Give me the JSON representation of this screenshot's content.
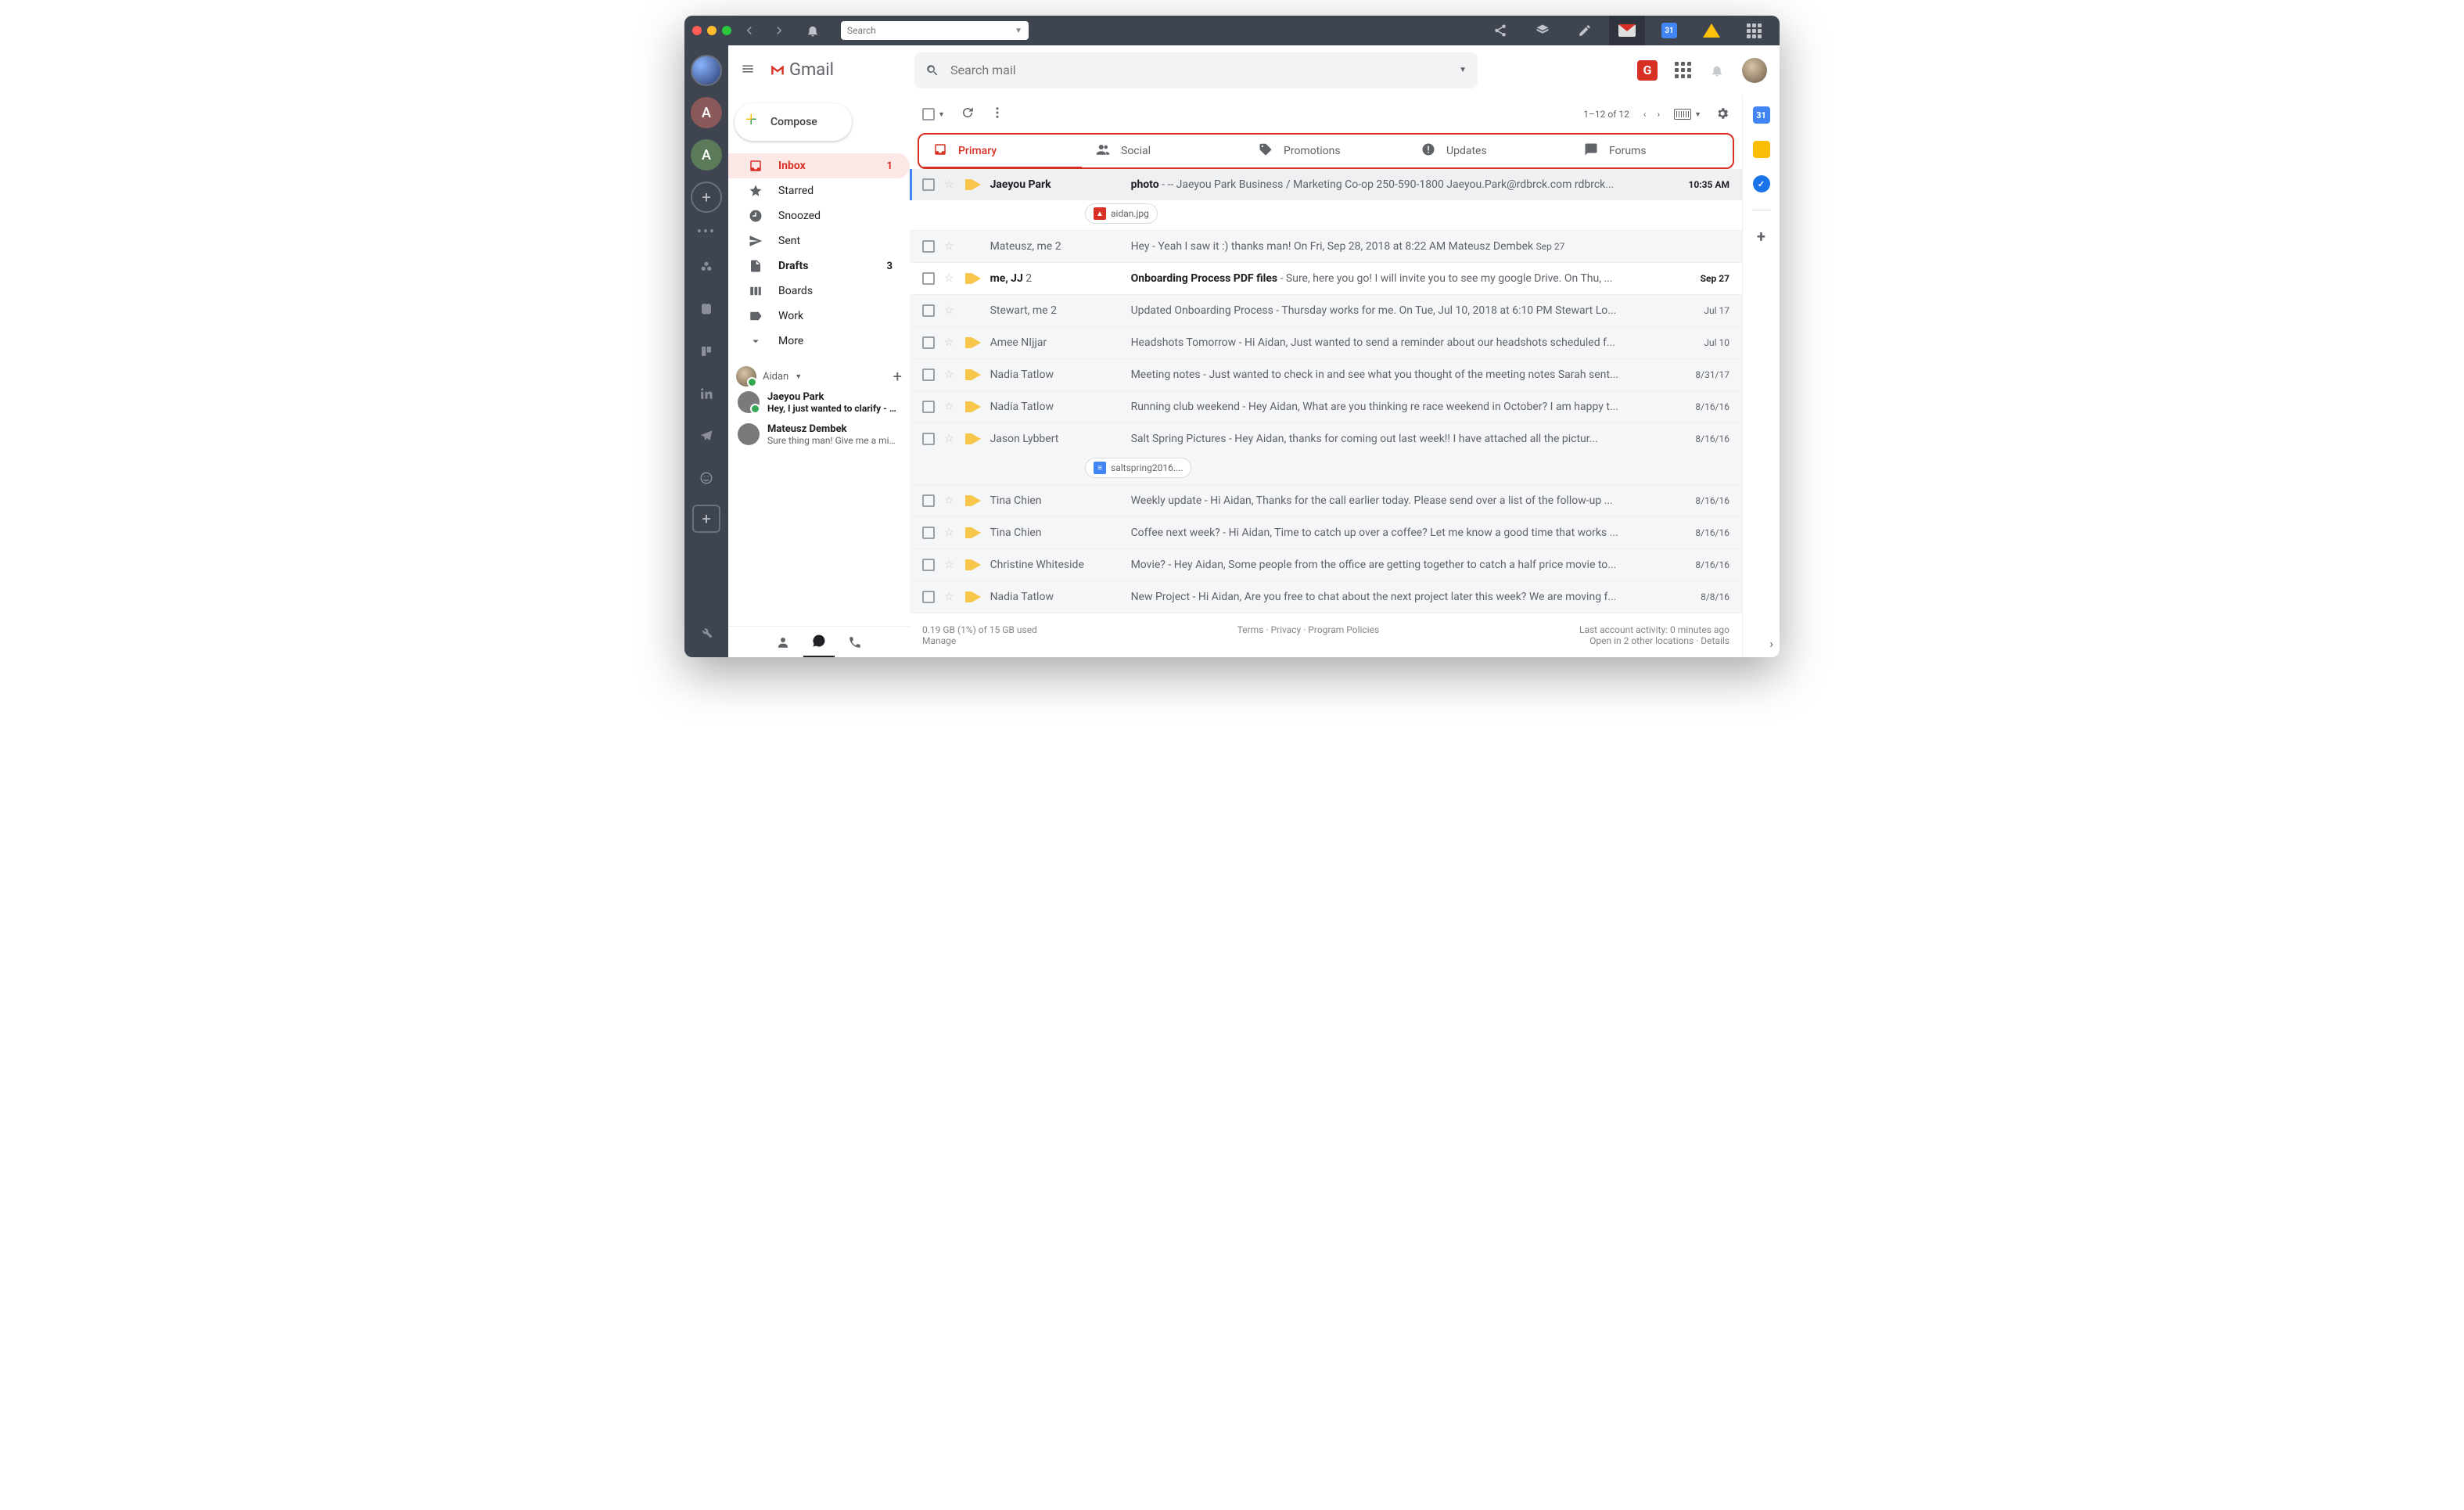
{
  "titlebar": {
    "search_placeholder": "Search"
  },
  "rail": {
    "avatars": [
      "photo",
      "A",
      "A"
    ]
  },
  "header": {
    "app_name": "Gmail",
    "search_placeholder": "Search mail"
  },
  "compose_label": "Compose",
  "nav": [
    {
      "icon": "inbox",
      "label": "Inbox",
      "count": "1",
      "active": true
    },
    {
      "icon": "star",
      "label": "Starred"
    },
    {
      "icon": "clock",
      "label": "Snoozed"
    },
    {
      "icon": "send",
      "label": "Sent"
    },
    {
      "icon": "file",
      "label": "Drafts",
      "count": "3",
      "bold": true
    },
    {
      "icon": "board",
      "label": "Boards"
    },
    {
      "icon": "label",
      "label": "Work"
    },
    {
      "icon": "chev",
      "label": "More"
    }
  ],
  "hangouts": {
    "me": "Aidan",
    "chats": [
      {
        "name": "Jaeyou Park",
        "preview": "Hey, I just wanted to clarify - did yo",
        "online": true,
        "bold": true
      },
      {
        "name": "Mateusz Dembek",
        "preview": "Sure thing man! Give me a minute."
      }
    ]
  },
  "toolbar": {
    "range": "1–12 of 12"
  },
  "categories": [
    {
      "label": "Primary",
      "active": true
    },
    {
      "label": "Social"
    },
    {
      "label": "Promotions"
    },
    {
      "label": "Updates"
    },
    {
      "label": "Forums"
    }
  ],
  "emails": [
    {
      "sender": "Jaeyou Park",
      "subject": "photo",
      "snippet": " - -- Jaeyou Park Business / Marketing Co-op 250-590-1800 Jaeyou.Park@rdbrck.com rdbrck...",
      "date": "10:35 AM",
      "unread": true,
      "first": true,
      "attachment": {
        "name": "aidan.jpg",
        "type": "img"
      }
    },
    {
      "sender": "Mateusz, me",
      "count": "2",
      "subject": "Hey",
      "snippet": " - Yeah I saw it :) thanks man! On Fri, Sep 28, 2018 at 8:22 AM Mateusz Dembek <contact@dem...",
      "date": "Sep 27",
      "noimp": true
    },
    {
      "sender": "me, JJ",
      "count": "2",
      "subject": "Onboarding Process PDF files",
      "snippet": " - Sure, here you go! I will invite you to see my google Drive. On Thu, ...",
      "date": "Sep 27",
      "unread": true
    },
    {
      "sender": "Stewart, me",
      "count": "2",
      "subject": "Updated Onboarding Process",
      "snippet": " - Thursday works for me. On Tue, Jul 10, 2018 at 6:10 PM Stewart Lo...",
      "date": "Jul 17",
      "noimp": true
    },
    {
      "sender": "Amee NIjjar",
      "subject": "Headshots Tomorrow",
      "snippet": " - Hi Aidan, Just wanted to send a reminder about our headshots scheduled f...",
      "date": "Jul 10"
    },
    {
      "sender": "Nadia Tatlow",
      "subject": "Meeting notes",
      "snippet": " - Just wanted to check in and see what you thought of the meeting notes Sarah sent...",
      "date": "8/31/17"
    },
    {
      "sender": "Nadia Tatlow",
      "subject": "Running club weekend",
      "snippet": " - Hey Aidan, What are you thinking re race weekend in October? I am happy t...",
      "date": "8/16/16"
    },
    {
      "sender": "Jason Lybbert",
      "subject": "Salt Spring Pictures",
      "snippet": " - Hey Aidan, thanks for coming out last week!! I have attached all the pictur...",
      "date": "8/16/16",
      "attachment": {
        "name": "saltspring2016....",
        "type": "doc"
      }
    },
    {
      "sender": "Tina Chien",
      "subject": "Weekly update",
      "snippet": " - Hi Aidan, Thanks for the call earlier today. Please send over a list of the follow-up ...",
      "date": "8/16/16"
    },
    {
      "sender": "Tina Chien",
      "subject": "Coffee next week?",
      "snippet": " - Hi Aidan, Time to catch up over a coffee? Let me know a good time that works ...",
      "date": "8/16/16"
    },
    {
      "sender": "Christine Whiteside",
      "subject": "Movie?",
      "snippet": " - Hey Aidan, Some people from the office are getting together to catch a half price movie to...",
      "date": "8/16/16"
    },
    {
      "sender": "Nadia Tatlow",
      "subject": "New Project",
      "snippet": " - Hi Aidan, Are you free to chat about the next project later this week? We are moving f...",
      "date": "8/8/16"
    }
  ],
  "footer": {
    "storage": "0.19 GB (1%) of 15 GB used",
    "manage": "Manage",
    "links": "Terms · Privacy · Program Policies",
    "activity": "Last account activity: 0 minutes ago",
    "locations": "Open in 2 other locations · Details"
  },
  "calendar_badge": "31"
}
